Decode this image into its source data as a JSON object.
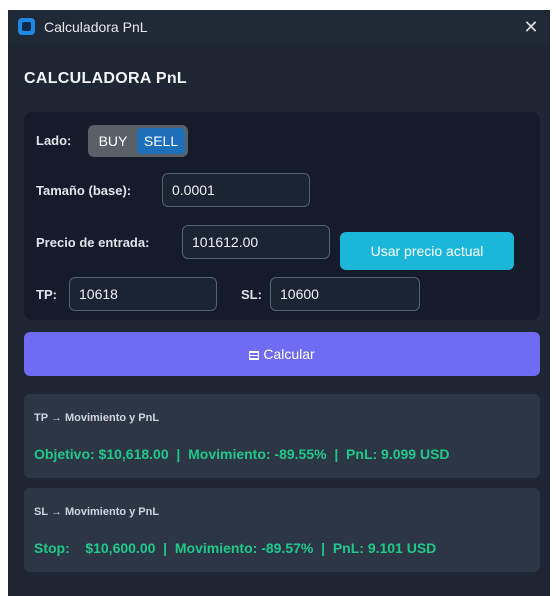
{
  "window": {
    "title": "Calculadora PnL",
    "close_symbol": "✕"
  },
  "heading": "CALCULADORA PnL",
  "form": {
    "side_label": "Lado:",
    "side_options": [
      "BUY",
      "SELL"
    ],
    "side_selected": "SELL",
    "size_label": "Tamaño (base):",
    "size_value": "0.0001",
    "entry_label": "Precio de entrada:",
    "entry_value": "101612.00",
    "use_price_button": "Usar precio actual",
    "tp_label": "TP:",
    "tp_value": "10618",
    "sl_label": "SL:",
    "sl_value": "10600"
  },
  "calculate_button": "Calcular",
  "results": {
    "tp": {
      "title": "TP → Movimiento y PnL",
      "line": "Objetivo: $10,618.00  |  Movimiento: -89.55%  |  PnL: 9.099 USD"
    },
    "sl": {
      "title": "SL → Movimiento y PnL",
      "line": "Stop:    $10,600.00  |  Movimiento: -89.57%  |  PnL: 9.101 USD"
    }
  },
  "colors": {
    "background": "#1e2633",
    "panel": "#141b2a",
    "accent_cyan": "#1bb7da",
    "accent_purple": "#6f6bf2",
    "selected_side": "#1c6fb8",
    "result_text": "#1fc98a"
  }
}
